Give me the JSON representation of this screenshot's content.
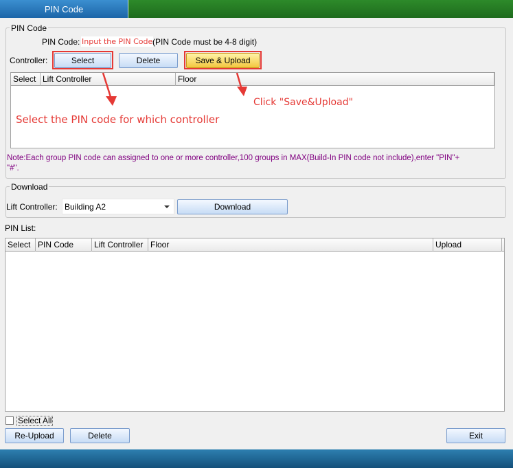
{
  "tab": {
    "label": "PIN Code"
  },
  "pin_group": {
    "legend": "PIN Code",
    "pin_label": "PIN Code:",
    "pin_placeholder": "Input the PIN Code",
    "pin_hint": "(PIN Code must be 4-8 digit)",
    "controller_label": "Controller:",
    "select_button": "Select",
    "delete_button": "Delete",
    "save_upload_button": "Save & Upload",
    "grid_columns": [
      "Select",
      "Lift Controller",
      "Floor"
    ],
    "annotation_select": "Select the PIN code for which controller",
    "annotation_save": "Click \"Save&Upload\"",
    "note_line1": "Note:Each group PIN code can assigned to one or more controller,100 groups in MAX(Build-In PIN code not include),enter \"PIN\"+",
    "note_line2": "\"#\"."
  },
  "download_group": {
    "legend": "Download",
    "lift_controller_label": "Lift Controller:",
    "lift_controller_value": "Building A2",
    "download_button": "Download"
  },
  "pin_list": {
    "label": "PIN List:",
    "columns": [
      "Select",
      "PIN Code",
      "Lift Controller",
      "Floor",
      "Upload"
    ]
  },
  "footer": {
    "select_all_label": "Select All",
    "reupload_button": "Re-Upload",
    "delete_button": "Delete",
    "exit_button": "Exit"
  },
  "colors": {
    "annotation_red": "#e53935",
    "note_purple": "#800080",
    "title_green": "#1e6b1d",
    "tab_blue": "#1c65a8"
  }
}
